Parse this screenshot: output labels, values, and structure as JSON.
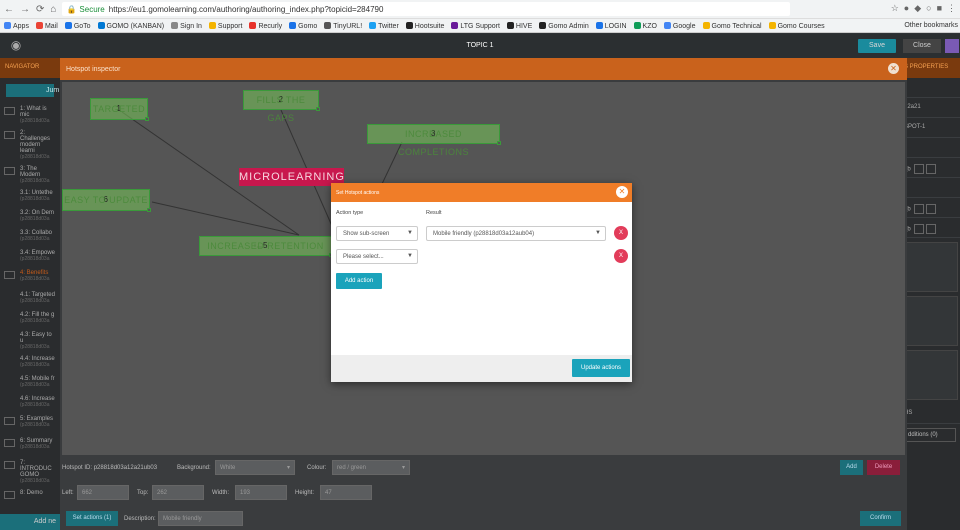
{
  "browser": {
    "secure_label": "Secure",
    "url": "https://eu1.gomolearning.com/authoring/authoring_index.php?topicid=284790",
    "bookmarks": [
      "Apps",
      "Mail",
      "GoTo",
      "GOMO (KANBAN)",
      "Sign In",
      "Support",
      "Recurly",
      "Gomo",
      "TinyURL!",
      "Twitter",
      "Hootsuite",
      "LTG Support",
      "HIVE",
      "Gomo Admin",
      "LOGIN",
      "KZO",
      "Google",
      "Gomo Technical",
      "Gomo Courses"
    ],
    "other_bookmarks": "Other bookmarks"
  },
  "app": {
    "title": "TOPIC 1",
    "save_label": "Save",
    "close_label": "Close"
  },
  "navigator": {
    "header": "NAVIGATOR",
    "jump_label": "Jum",
    "items": [
      {
        "label": "1: What is mic",
        "sub": "(p28818d03a"
      },
      {
        "label": "2: Challenges modern learni",
        "sub": "(p28818d03a"
      },
      {
        "label": "3: The Modern",
        "sub": "(p28818d03a"
      },
      {
        "label": "3.1: Untethe",
        "sub": "(p28818d03a"
      },
      {
        "label": "3.2: On Dem",
        "sub": "(p28818d03a"
      },
      {
        "label": "3.3: Collabo",
        "sub": "(p28818d03a"
      },
      {
        "label": "3.4: Empowe",
        "sub": "(p28818d03a"
      },
      {
        "label": "4: Benefits",
        "sub": "(p28818d03a"
      },
      {
        "label": "4.1: Targeted",
        "sub": "(p28818d03a"
      },
      {
        "label": "4.2: Fill the g",
        "sub": "(p28818d03a"
      },
      {
        "label": "4.3: Easy to u",
        "sub": "(p28818d03a"
      },
      {
        "label": "4.4: Increase",
        "sub": "(p28818d03a"
      },
      {
        "label": "4.5: Mobile fr",
        "sub": "(p28818d03a"
      },
      {
        "label": "4.6: Increase",
        "sub": "(p28818d03a"
      },
      {
        "label": "5: Examples",
        "sub": "(p28818d03a"
      },
      {
        "label": "6: Summary",
        "sub": "(p28818d03a"
      },
      {
        "label": "7: INTRODUC GOMO",
        "sub": "(p28818d03a"
      },
      {
        "label": "8: Demo",
        "sub": ""
      }
    ],
    "add_new_label": "Add ne"
  },
  "properties": {
    "header": "S PROPERTIES",
    "row1": "12a21",
    "row2": "SPOT-1",
    "hs_label": "HS",
    "additions_label": "dditions (0)"
  },
  "inspector": {
    "title": "Hotspot inspector",
    "center_label": "MICROLEARNING",
    "hotspots": [
      {
        "num": "1",
        "label": "TARGETED"
      },
      {
        "num": "2",
        "label": "FILLS THE GAPS"
      },
      {
        "num": "3",
        "label": "INCREASED COMPLETIONS"
      },
      {
        "num": "6",
        "label": "EASY TO UPDATE"
      },
      {
        "num": "5",
        "label": "INCREASED RETENTION"
      }
    ],
    "hotspot_id_label": "Hotspot ID:",
    "hotspot_id": "p28818d03a12a21ub03",
    "background_label": "Background:",
    "background_value": "White",
    "colour_label": "Colour:",
    "colour_value": "red / green",
    "add_label": "Add",
    "delete_label": "Delete",
    "left_label": "Left:",
    "left_value": "662",
    "top_label": "Top:",
    "top_value": "262",
    "width_label": "Width:",
    "width_value": "193",
    "height_label": "Height:",
    "height_value": "47",
    "set_actions_label": "Set actions (1)",
    "description_label": "Description:",
    "description_value": "Mobile friendly",
    "confirm_label": "Confirm"
  },
  "dialog": {
    "title": "Set Hotspot actions",
    "action_type_label": "Action type",
    "result_label": "Result",
    "row1_action": "Show sub-screen",
    "row1_result": "Mobile friendly (p28818d03a12aub04)",
    "row2_action": "Please select...",
    "remove_label": "X",
    "add_action_label": "Add action",
    "update_label": "Update actions"
  },
  "colors": {
    "orange_header": "#c9621c",
    "dialog_header": "#f07d28",
    "teal": "#1aa3bb",
    "remove_red": "#e23c5a",
    "micro_red": "#c8174d",
    "hotspot_green": "#78c85a"
  }
}
